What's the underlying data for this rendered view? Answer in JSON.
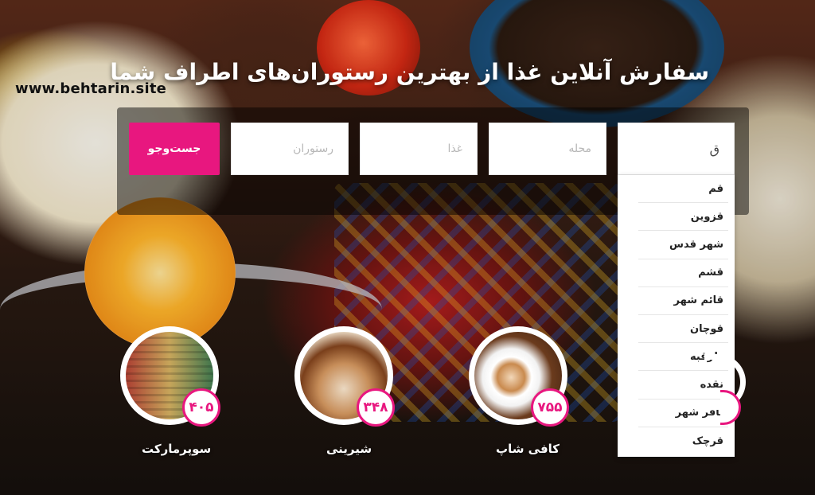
{
  "site": {
    "url": "www.behtarin.site"
  },
  "hero": {
    "headline": "سفارش آنلاین غذا از بهترین رستوران‌های اطراف شما"
  },
  "search": {
    "city_value": "ق",
    "area_placeholder": "محله",
    "food_placeholder": "غذا",
    "restaurant_placeholder": "رستوران",
    "button_label": "جست‌وجو"
  },
  "city_suggestions": [
    "قم",
    "قزوین",
    "شهر قدس",
    "قشم",
    "قائم شهر",
    "قوچان",
    "طرقبه",
    "نقده",
    "باقر شهر",
    "قرچک"
  ],
  "categories": [
    {
      "label": "کافی شاپ",
      "count": "۷۵۵",
      "icon": "coffee-image"
    },
    {
      "label": "شیرینی",
      "count": "۳۴۸",
      "icon": "pastry-image"
    },
    {
      "label": "سوپرمارکت",
      "count": "۴۰۵",
      "icon": "supermarket-image"
    }
  ],
  "colors": {
    "accent": "#e8177f"
  }
}
